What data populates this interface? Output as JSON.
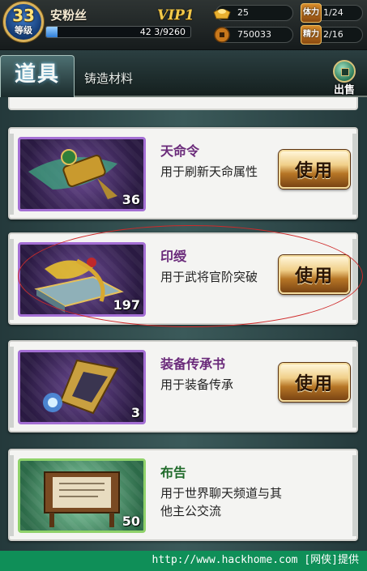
{
  "player": {
    "level": "33",
    "level_label": "等级",
    "name": "安粉丝",
    "vip": "VIP1",
    "exp_left": "42",
    "exp_text": "3/9260",
    "exp_fraction": 0.08
  },
  "stats": {
    "gold": "25",
    "coins": "750033",
    "stamina_label": "体力",
    "stamina": "1/24",
    "energy_label": "精力",
    "energy": "2/16"
  },
  "tabs": {
    "active": "道具",
    "second": "铸造材料",
    "sell": "出售"
  },
  "items": [
    {
      "name": "天命令",
      "desc": "用于刷新天命属性",
      "count": "36",
      "button": "使用"
    },
    {
      "name": "印绶",
      "desc": "用于武将官阶突破",
      "count": "197",
      "button": "使用"
    },
    {
      "name": "装备传承书",
      "desc": "用于装备传承",
      "count": "3",
      "button": "使用"
    },
    {
      "name": "布告",
      "desc": "用于世界聊天频道与其他主公交流",
      "count": "50"
    }
  ],
  "footer": "http://www.hackhome.com [网侠]提供",
  "colors": {
    "rare_frame": "#a46fd4",
    "uncommon_frame": "#8fd26a",
    "annotation": "#cf2a2a",
    "footer_bg": "#0f8f58"
  },
  "icons": [
    "gold-ingot-icon",
    "coin-icon",
    "sell-coin-icon"
  ]
}
